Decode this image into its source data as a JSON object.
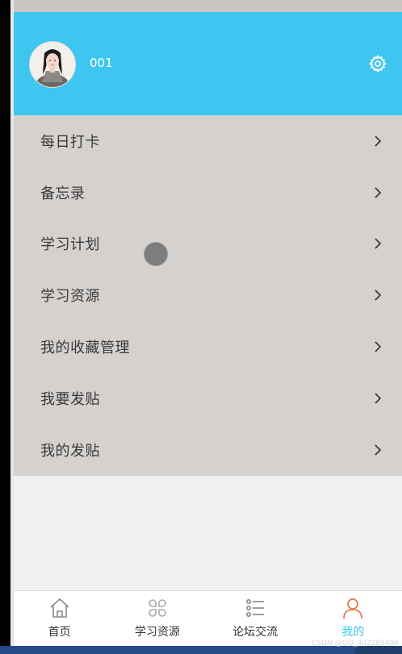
{
  "profile": {
    "username": "001",
    "header_color": "#3ec6f1"
  },
  "menu": {
    "items": [
      {
        "label": "每日打卡"
      },
      {
        "label": "备忘录"
      },
      {
        "label": "学习计划"
      },
      {
        "label": "学习资源"
      },
      {
        "label": "我的收藏管理"
      },
      {
        "label": "我要发贴"
      },
      {
        "label": "我的发贴"
      }
    ]
  },
  "tabbar": {
    "tabs": [
      {
        "label": "首页",
        "icon": "home-icon"
      },
      {
        "label": "学习资源",
        "icon": "grid-icon"
      },
      {
        "label": "论坛交流",
        "icon": "list-icon"
      },
      {
        "label": "我的",
        "icon": "person-icon",
        "active": true
      }
    ],
    "active_color": "#3ec6f1",
    "active_icon_color": "#e07b4f"
  },
  "watermark": "CSDN @QQ_402285496"
}
